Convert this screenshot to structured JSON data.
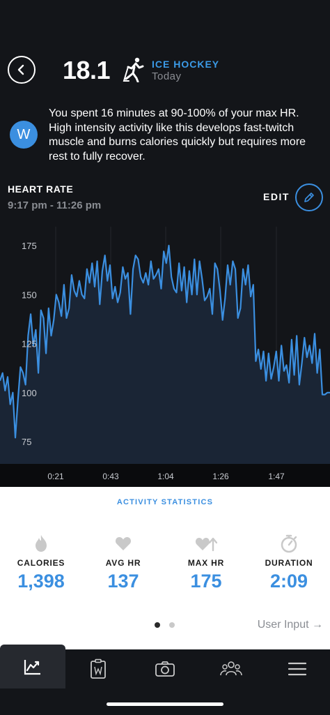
{
  "header": {
    "score": "18.1",
    "sport": "ICE HOCKEY",
    "date": "Today",
    "icons": {
      "back": "back-arrow-icon",
      "sport": "ice-hockey-player-icon"
    }
  },
  "insight": {
    "badge": "W",
    "text": "You spent 16 minutes at 90-100% of your max HR. High intensity activity like this develops fast-twitch muscle and burns calories quickly but requires more rest to fully recover."
  },
  "heart_rate": {
    "title": "HEART RATE",
    "range": "9:17 pm - 11:26 pm",
    "edit_label": "EDIT"
  },
  "chart_data": {
    "type": "area",
    "y_ticks": [
      "175",
      "150",
      "125",
      "100",
      "75"
    ],
    "x_ticks": [
      "0:21",
      "0:43",
      "1:04",
      "1:26",
      "1:47"
    ],
    "ylim": [
      75,
      175
    ],
    "xlim": [
      0,
      129
    ],
    "color": "#3b8fe0",
    "grid": true,
    "series": [
      {
        "x": [
          0,
          1,
          2,
          3,
          4,
          5,
          6,
          7,
          8,
          9,
          10,
          11,
          12,
          13,
          14,
          15,
          16,
          17,
          18,
          19,
          20,
          21,
          22,
          23,
          24,
          25,
          26,
          27,
          28,
          29,
          30,
          31,
          32,
          33,
          34,
          35,
          36,
          37,
          38,
          39,
          40,
          41,
          42,
          43,
          44,
          45,
          46,
          47,
          48,
          49,
          50,
          51,
          52,
          53,
          54,
          55,
          56,
          57,
          58,
          59,
          60,
          61,
          62,
          63,
          64,
          65,
          66,
          67,
          68,
          69,
          70,
          71,
          72,
          73,
          74,
          75,
          76,
          77,
          78,
          79,
          80,
          81,
          82,
          83,
          84,
          85,
          86,
          87,
          88,
          89,
          90,
          91,
          92,
          93,
          94,
          95,
          96,
          97,
          98,
          99,
          100,
          101,
          102,
          103,
          104,
          105,
          106,
          107,
          108,
          109,
          110,
          111,
          112,
          113,
          114,
          115,
          116,
          117,
          118,
          119,
          120,
          121,
          122,
          123,
          124,
          125,
          126,
          127,
          128,
          129
        ],
        "y": [
          106,
          110,
          101,
          108,
          94,
          100,
          77,
          96,
          113,
          110,
          104,
          129,
          140,
          124,
          132,
          110,
          142,
          138,
          120,
          143,
          129,
          137,
          150,
          146,
          139,
          155,
          138,
          143,
          160,
          152,
          149,
          157,
          150,
          148,
          163,
          156,
          166,
          154,
          167,
          145,
          162,
          170,
          157,
          165,
          148,
          154,
          146,
          151,
          164,
          158,
          161,
          140,
          163,
          170,
          168,
          159,
          156,
          161,
          155,
          167,
          158,
          160,
          163,
          153,
          172,
          166,
          175,
          159,
          153,
          151,
          166,
          152,
          164,
          146,
          162,
          150,
          168,
          150,
          167,
          158,
          147,
          149,
          153,
          140,
          166,
          163,
          152,
          137,
          148,
          165,
          155,
          167,
          163,
          138,
          143,
          163,
          155,
          165,
          149,
          155,
          116,
          122,
          112,
          121,
          106,
          120,
          107,
          113,
          121,
          106,
          124,
          111,
          114,
          105,
          127,
          109,
          129,
          104,
          115,
          128,
          118,
          124,
          115,
          130,
          110,
          122,
          99,
          99,
          100,
          100
        ]
      }
    ]
  },
  "stats": {
    "title": "ACTIVITY STATISTICS",
    "items": [
      {
        "label": "CALORIES",
        "value": "1,398",
        "icon": "flame-icon"
      },
      {
        "label": "AVG HR",
        "value": "137",
        "icon": "heart-icon"
      },
      {
        "label": "MAX HR",
        "value": "175",
        "icon": "heart-up-arrow-icon"
      },
      {
        "label": "DURATION",
        "value": "2:09",
        "icon": "stopwatch-icon"
      }
    ],
    "user_input": "User Input →",
    "pages": 2,
    "active_page": 1
  },
  "nav": {
    "items": [
      {
        "icon": "trend-chart-icon",
        "active": true
      },
      {
        "icon": "clipboard-icon",
        "active": false
      },
      {
        "icon": "camera-icon",
        "active": false
      },
      {
        "icon": "team-icon",
        "active": false
      },
      {
        "icon": "menu-icon",
        "active": false
      }
    ]
  },
  "colors": {
    "accent": "#3b8fe0",
    "background": "#131519",
    "muted": "#8a8d93"
  }
}
